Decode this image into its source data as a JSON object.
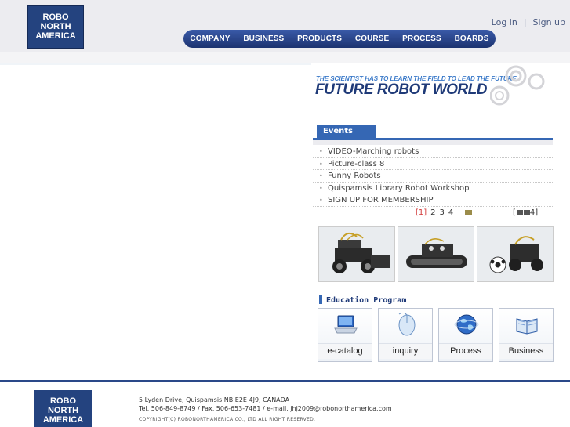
{
  "header": {
    "logo_lines": [
      "ROBO",
      "NORTH",
      "AMERICA"
    ],
    "links": {
      "login": "Log in",
      "separator": "|",
      "signup": "Sign up"
    },
    "nav": [
      "COMPANY",
      "BUSINESS",
      "PRODUCTS",
      "COURSE",
      "PROCESS",
      "BOARDS"
    ]
  },
  "banner": {
    "tagline": "THE SCIENTIST HAS TO LEARN THE FIELD TO LEAD THE FUTURE",
    "headline": "FUTURE ROBOT WORLD"
  },
  "events": {
    "tab_label": "Events",
    "items": [
      "VIDEO-Marching robots",
      "Picture-class 8",
      "Funny Robots",
      "Quispamsis Library Robot Workshop",
      "SIGN UP FOR MEMBERSHIP"
    ],
    "pager": {
      "current": "[1]",
      "pages": [
        "2",
        "3",
        "4"
      ]
    },
    "slide_control": {
      "open": "[",
      "close": "4]"
    }
  },
  "education": {
    "title": "Education Program",
    "cards": [
      "e-catalog",
      "inquiry",
      "Process",
      "Business"
    ]
  },
  "footer": {
    "logo_lines": [
      "ROBO",
      "NORTH",
      "AMERICA"
    ],
    "address": "5 Lyden Drive, Quispamsis NB E2E 4J9, CANADA",
    "contact": "Tel, 506-849-8749  /  Fax, 506-653-7481  /  e-mail, jhj2009@robonorthamerica.com",
    "copyright": "COPYRIGHT(C) ROBONORTHAMERICA CO., LTD ALL RIGHT RESERVED."
  },
  "colors": {
    "brand_navy": "#24437f",
    "accent_blue": "#3567b4",
    "pager_current": "#d23a3a"
  }
}
